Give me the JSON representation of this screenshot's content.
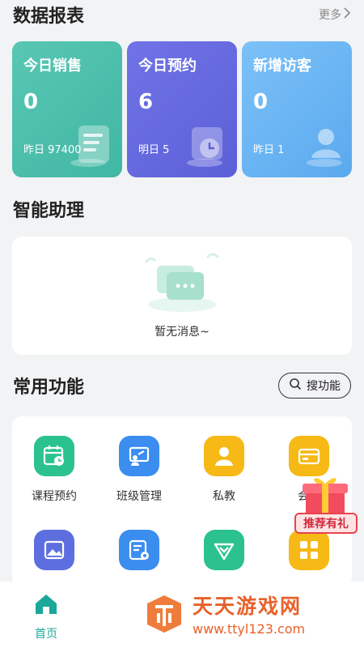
{
  "report": {
    "title": "数据报表",
    "more_label": "更多",
    "cards": [
      {
        "label": "今日销售",
        "value": "0",
        "sub": "昨日 97400"
      },
      {
        "label": "今日预约",
        "value": "6",
        "sub": "明日 5"
      },
      {
        "label": "新增访客",
        "value": "0",
        "sub": "昨日 1"
      }
    ]
  },
  "assistant": {
    "title": "智能助理",
    "empty_text": "暂无消息~"
  },
  "functions": {
    "title": "常用功能",
    "search_label": "搜功能",
    "items": [
      {
        "label": "课程预约",
        "icon": "calendar-clock-icon",
        "color": "#2bc28f"
      },
      {
        "label": "班级管理",
        "icon": "class-board-icon",
        "color": "#3b8df0"
      },
      {
        "label": "私教",
        "icon": "user-icon",
        "color": "#f6b915"
      },
      {
        "label": "会员",
        "icon": "card-icon",
        "color": "#f6b915"
      },
      {
        "label": "",
        "icon": "image-icon",
        "color": "#5d6fe0"
      },
      {
        "label": "",
        "icon": "settings-doc-icon",
        "color": "#3b8df0"
      },
      {
        "label": "",
        "icon": "check-shield-icon",
        "color": "#2bc28f"
      },
      {
        "label": "",
        "icon": "apps-icon",
        "color": "#f6b915"
      }
    ]
  },
  "promo": {
    "label": "推荐有礼"
  },
  "tabbar": {
    "home_label": "首页"
  },
  "watermark": {
    "name": "天天游戏网",
    "url": "www.ttyl123.com"
  }
}
